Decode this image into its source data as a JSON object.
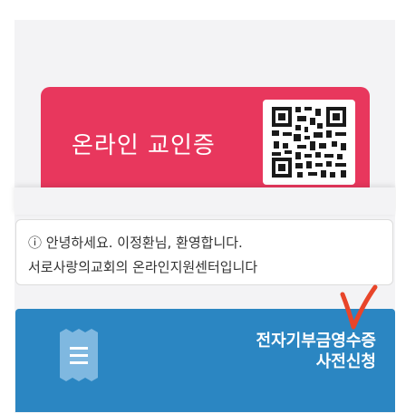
{
  "id_card": {
    "title": "온라인 교인증",
    "color": "#e8375d",
    "qr_icon": "qr-code-icon"
  },
  "greeting": {
    "line1": "ⓘ 안녕하세요. 이정환님, 환영합니다.",
    "line2": "서로사랑의교회의 온라인지원센터입니다"
  },
  "receipt_banner": {
    "line1": "전자기부금영수증",
    "line2": "사전신청",
    "icon": "receipt-icon",
    "color": "#2b86c2"
  },
  "annotation": {
    "icon": "check-mark-icon",
    "color": "#e8452a"
  }
}
